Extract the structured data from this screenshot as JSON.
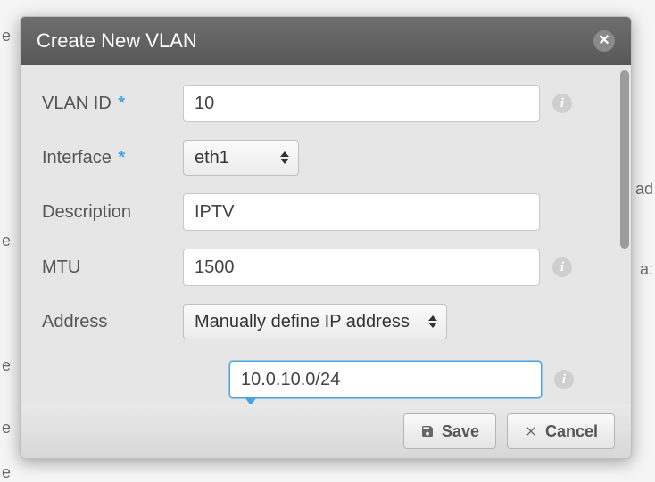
{
  "dialog": {
    "title": "Create New VLAN"
  },
  "fields": {
    "vlan_id": {
      "label": "VLAN ID",
      "required": true,
      "value": "10"
    },
    "interface": {
      "label": "Interface",
      "required": true,
      "value": "eth1"
    },
    "description": {
      "label": "Description",
      "value": "IPTV"
    },
    "mtu": {
      "label": "MTU",
      "value": "1500"
    },
    "address": {
      "label": "Address",
      "mode": "Manually define IP address",
      "ip_value": "10.0.10.0/24"
    }
  },
  "footer": {
    "save": "Save",
    "cancel": "Cancel"
  },
  "glyphs": {
    "info": "i",
    "close": "✕",
    "required": "*"
  }
}
